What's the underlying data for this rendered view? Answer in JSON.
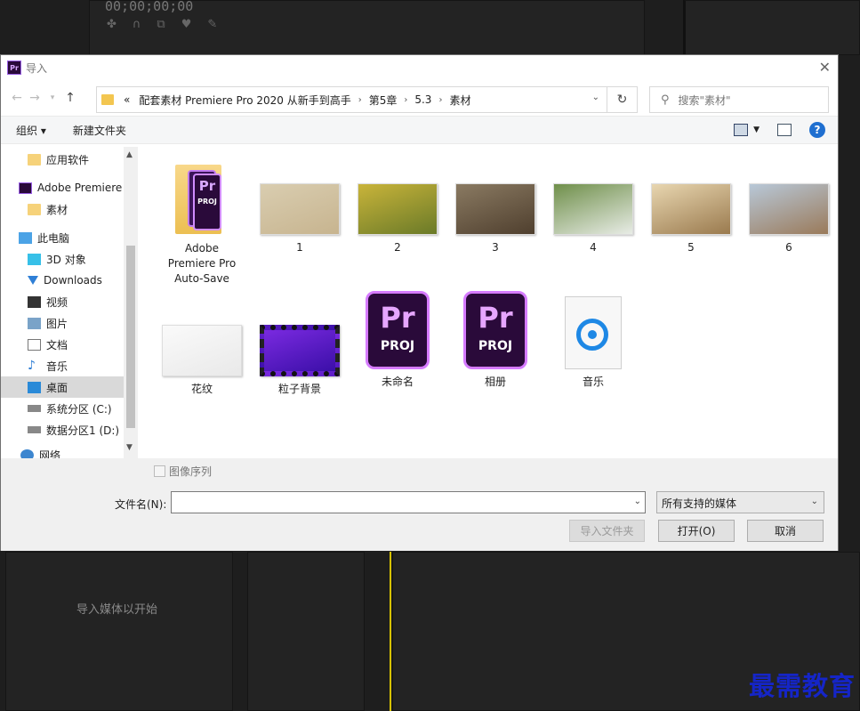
{
  "background": {
    "timecode": "00;00;00;00",
    "hint": "导入媒体以开始"
  },
  "watermark": "最需教育",
  "dialog": {
    "title": "导入",
    "address": {
      "prefix": "«",
      "crumbs": [
        "配套素材 Premiere Pro 2020 从新手到高手",
        "第5章",
        "5.3",
        "素材"
      ]
    },
    "search_placeholder": "搜索\"素材\"",
    "toolbar": {
      "organize": "组织 ▾",
      "new_folder": "新建文件夹",
      "help": "?"
    },
    "sidebar": [
      {
        "label": "应用软件",
        "icon": "folder-icon"
      },
      {
        "label": "Adobe Premiere",
        "icon": "premiere-icon"
      },
      {
        "label": "素材",
        "icon": "folder-icon"
      },
      {
        "label": "此电脑",
        "icon": "computer-icon"
      },
      {
        "label": "3D 对象",
        "icon": "3d-objects-icon"
      },
      {
        "label": "Downloads",
        "icon": "download-icon"
      },
      {
        "label": "视频",
        "icon": "video-icon"
      },
      {
        "label": "图片",
        "icon": "picture-icon"
      },
      {
        "label": "文档",
        "icon": "document-icon"
      },
      {
        "label": "音乐",
        "icon": "music-icon"
      },
      {
        "label": "桌面",
        "icon": "desktop-icon"
      },
      {
        "label": "系统分区 (C:)",
        "icon": "drive-icon"
      },
      {
        "label": "数据分区1 (D:)",
        "icon": "drive-icon"
      },
      {
        "label": "网络",
        "icon": "network-icon"
      }
    ],
    "files": [
      {
        "name": "Adobe Premiere Pro Auto-Save",
        "kind": "premiere-folder"
      },
      {
        "name": "1",
        "kind": "image",
        "colors": [
          "#d9cdb0",
          "#c7b48f"
        ]
      },
      {
        "name": "2",
        "kind": "image",
        "colors": [
          "#c9b43a",
          "#6a7a28"
        ]
      },
      {
        "name": "3",
        "kind": "image",
        "colors": [
          "#8a7a62",
          "#4f3f2e"
        ]
      },
      {
        "name": "4",
        "kind": "image",
        "colors": [
          "#6f8f4a",
          "#e8ece6"
        ]
      },
      {
        "name": "5",
        "kind": "image",
        "colors": [
          "#e8d6b0",
          "#9a7a4e"
        ]
      },
      {
        "name": "6",
        "kind": "image",
        "colors": [
          "#b8c8d8",
          "#9a7a5a"
        ]
      },
      {
        "name": "花纹",
        "kind": "image",
        "colors": [
          "#fafafa",
          "#e9e9e9"
        ]
      },
      {
        "name": "粒子背景",
        "kind": "video",
        "colors": [
          "#7a2ae0",
          "#3b0fa8"
        ]
      },
      {
        "name": "未命名",
        "kind": "project"
      },
      {
        "name": "相册",
        "kind": "project"
      },
      {
        "name": "音乐",
        "kind": "audio"
      }
    ],
    "pr_label": "Pr",
    "proj_label": "PROJ",
    "image_sequence": "图像序列",
    "filename_label": "文件名(N):",
    "filename_value": "",
    "filter_value": "所有支持的媒体",
    "buttons": {
      "import_folder": "导入文件夹",
      "open": "打开(O)",
      "cancel": "取消"
    }
  }
}
